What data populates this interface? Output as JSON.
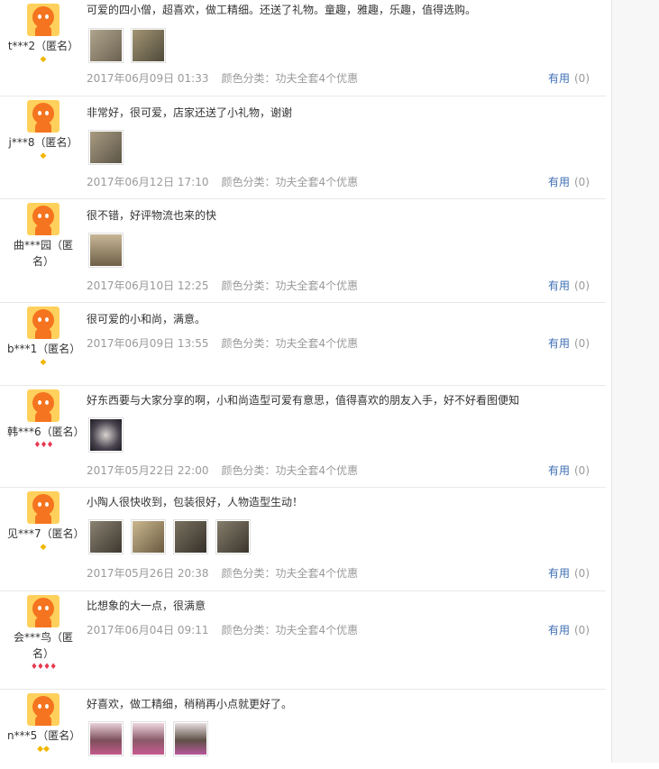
{
  "reviews": [
    {
      "user": "t***2（匿名）",
      "level": "◆",
      "level_type": "gold",
      "text": "可爱的四小僧，超喜欢，做工精细。还送了礼物。童趣，雅趣，乐趣，值得选购。",
      "photos": [
        "#8d8471",
        "#6f6a55"
      ],
      "date": "2017年06月09日 01:33",
      "color_label": "颜色分类：功夫全套4个优惠",
      "useful_label": "有用",
      "useful_count": "(0)"
    },
    {
      "user": "j***8（匿名）",
      "level": "◆",
      "level_type": "gold",
      "text": "非常好，很可爱，店家还送了小礼物，谢谢",
      "photos": [
        "#7a7262"
      ],
      "date": "2017年06月12日 17:10",
      "color_label": "颜色分类：功夫全套4个优惠",
      "useful_label": "有用",
      "useful_count": "(0)"
    },
    {
      "user": "曲***园（匿名）",
      "level": "",
      "level_type": "gold",
      "text": "很不错，好评物流也来的快",
      "photos": [
        "#8a7a60"
      ],
      "date": "2017年06月10日 12:25",
      "color_label": "颜色分类：功夫全套4个优惠",
      "useful_label": "有用",
      "useful_count": "(0)"
    },
    {
      "user": "b***1（匿名）",
      "level": "◆",
      "level_type": "gold",
      "text": "很可爱的小和尚，满意。",
      "photos": [],
      "date": "2017年06月09日 13:55",
      "color_label": "颜色分类：功夫全套4个优惠",
      "useful_label": "有用",
      "useful_count": "(0)"
    },
    {
      "user": "韩***6（匿名）",
      "level": "♦♦♦",
      "level_type": "red",
      "text": "好东西要与大家分享的啊，小和尚造型可爱有意思，值得喜欢的朋友入手，好不好看图便知",
      "photos": [
        "#4a4550"
      ],
      "date": "2017年05月22日 22:00",
      "color_label": "颜色分类：功夫全套4个优惠",
      "useful_label": "有用",
      "useful_count": "(0)"
    },
    {
      "user": "见***7（匿名）",
      "level": "◆",
      "level_type": "gold",
      "text": "小陶人很快收到，包装很好，人物造型生动！",
      "photos": [
        "#5d574b",
        "#9c8a6a",
        "#4f4a40",
        "#5a544a"
      ],
      "date": "2017年05月26日 20:38",
      "color_label": "颜色分类：功夫全套4个优惠",
      "useful_label": "有用",
      "useful_count": "(0)"
    },
    {
      "user": "会***鸟（匿名）",
      "level": "♦♦♦♦",
      "level_type": "red",
      "text": "比想象的大一点，很满意",
      "photos": [],
      "date": "2017年06月04日 09:11",
      "color_label": "颜色分类：功夫全套4个优惠",
      "useful_label": "有用",
      "useful_count": "(0)"
    },
    {
      "user": "n***5（匿名）",
      "level": "◆◆",
      "level_type": "gold",
      "text": "好喜欢，做工精细，稍稍再小点就更好了。",
      "photos": [
        "#7d4f5c",
        "#8a5a6a",
        "#5f5046"
      ],
      "date": "",
      "color_label": "",
      "useful_label": "",
      "useful_count": ""
    }
  ]
}
